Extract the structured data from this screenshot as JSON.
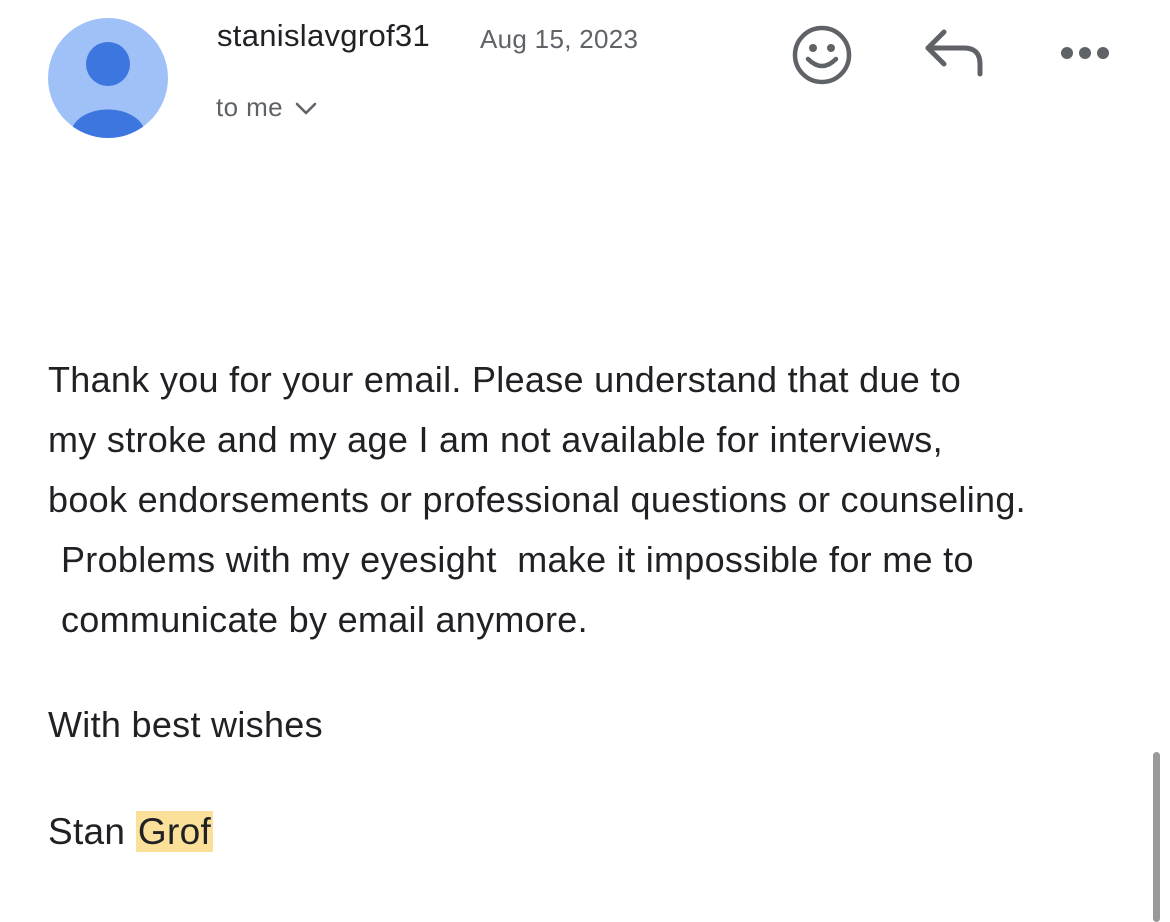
{
  "email": {
    "sender": "stanislavgrof31",
    "date": "Aug 15, 2023",
    "recipient": "to me",
    "body_lines": [
      "Thank you for your email. Please understand that due to",
      "my stroke and my age I am not available for interviews,",
      "book endorsements or professional questions or counseling.",
      "Problems with my eyesight  make it impossible for me to",
      "communicate by email anymore."
    ],
    "greeting": "With best wishes",
    "signature_first": "Stan",
    "signature_last": "Grof"
  },
  "icons": {
    "avatar": "person-icon",
    "emoji": "smiley-icon",
    "reply": "reply-icon",
    "more": "more-horizontal-icon",
    "expand": "chevron-down-icon"
  },
  "colors": {
    "avatar_bg": "#9fc1f8",
    "avatar_fg": "#3e76e0",
    "highlight": "#fbe09a",
    "icon": "#5f6368"
  }
}
